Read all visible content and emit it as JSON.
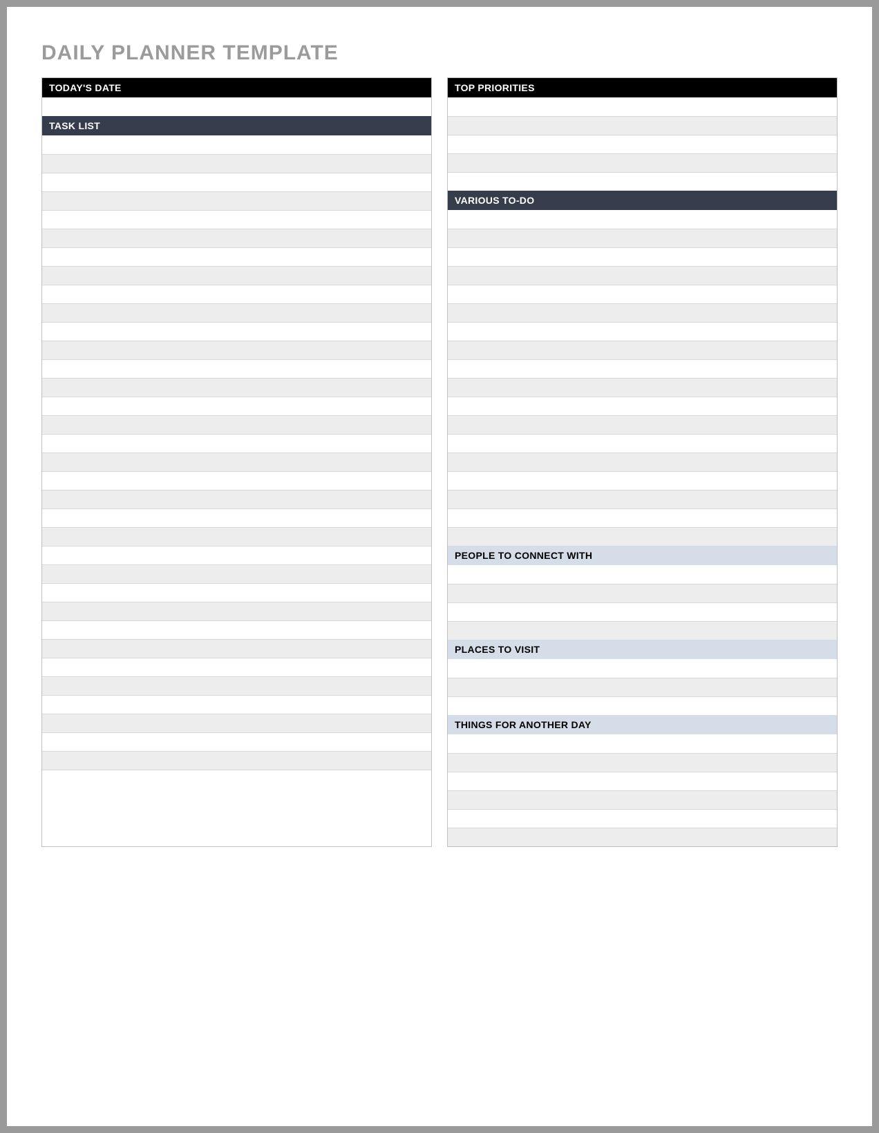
{
  "title": "DAILY PLANNER TEMPLATE",
  "left": {
    "todays_date_label": "TODAY'S DATE",
    "task_list_label": "TASK LIST",
    "date_rows": 1,
    "task_rows": 35
  },
  "right": {
    "top_priorities_label": "TOP PRIORITIES",
    "top_priorities_rows": 5,
    "various_todo_label": "VARIOUS TO-DO",
    "various_todo_rows": 18,
    "people_label": "PEOPLE TO CONNECT WITH",
    "people_rows": 4,
    "places_label": "PLACES TO VISIT",
    "places_rows": 3,
    "things_label": "THINGS FOR ANOTHER DAY",
    "things_rows": 6
  }
}
